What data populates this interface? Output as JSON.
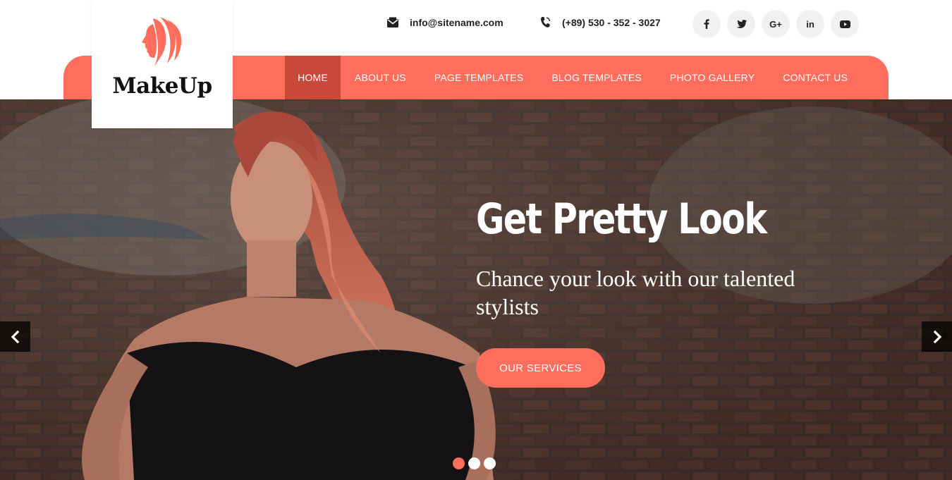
{
  "brand": {
    "name": "MakeUp",
    "accent": "#ff6e5c",
    "accent_dark": "#c8483a"
  },
  "contact": {
    "email": "info@sitename.com",
    "email_icon": "envelope-icon",
    "phone": "(+89) 530 - 352 - 3027",
    "phone_icon": "phone-icon"
  },
  "socials": [
    {
      "label": "f",
      "icon": "facebook-icon"
    },
    {
      "label": "t",
      "icon": "twitter-icon"
    },
    {
      "label": "G+",
      "icon": "google-plus-icon"
    },
    {
      "label": "in",
      "icon": "linkedin-icon"
    },
    {
      "label": "yt",
      "icon": "youtube-icon"
    }
  ],
  "nav": {
    "items": [
      {
        "label": "HOME",
        "active": true
      },
      {
        "label": "ABOUT US"
      },
      {
        "label": "PAGE TEMPLATES"
      },
      {
        "label": "BLOG TEMPLATES"
      },
      {
        "label": "PHOTO GALLERY"
      },
      {
        "label": "CONTACT US"
      }
    ]
  },
  "hero": {
    "title": "Get Pretty Look",
    "subtitle": "Chance your look with our talented stylists",
    "cta_label": "OUR SERVICES",
    "slides_total": 3,
    "active_slide": 1
  }
}
